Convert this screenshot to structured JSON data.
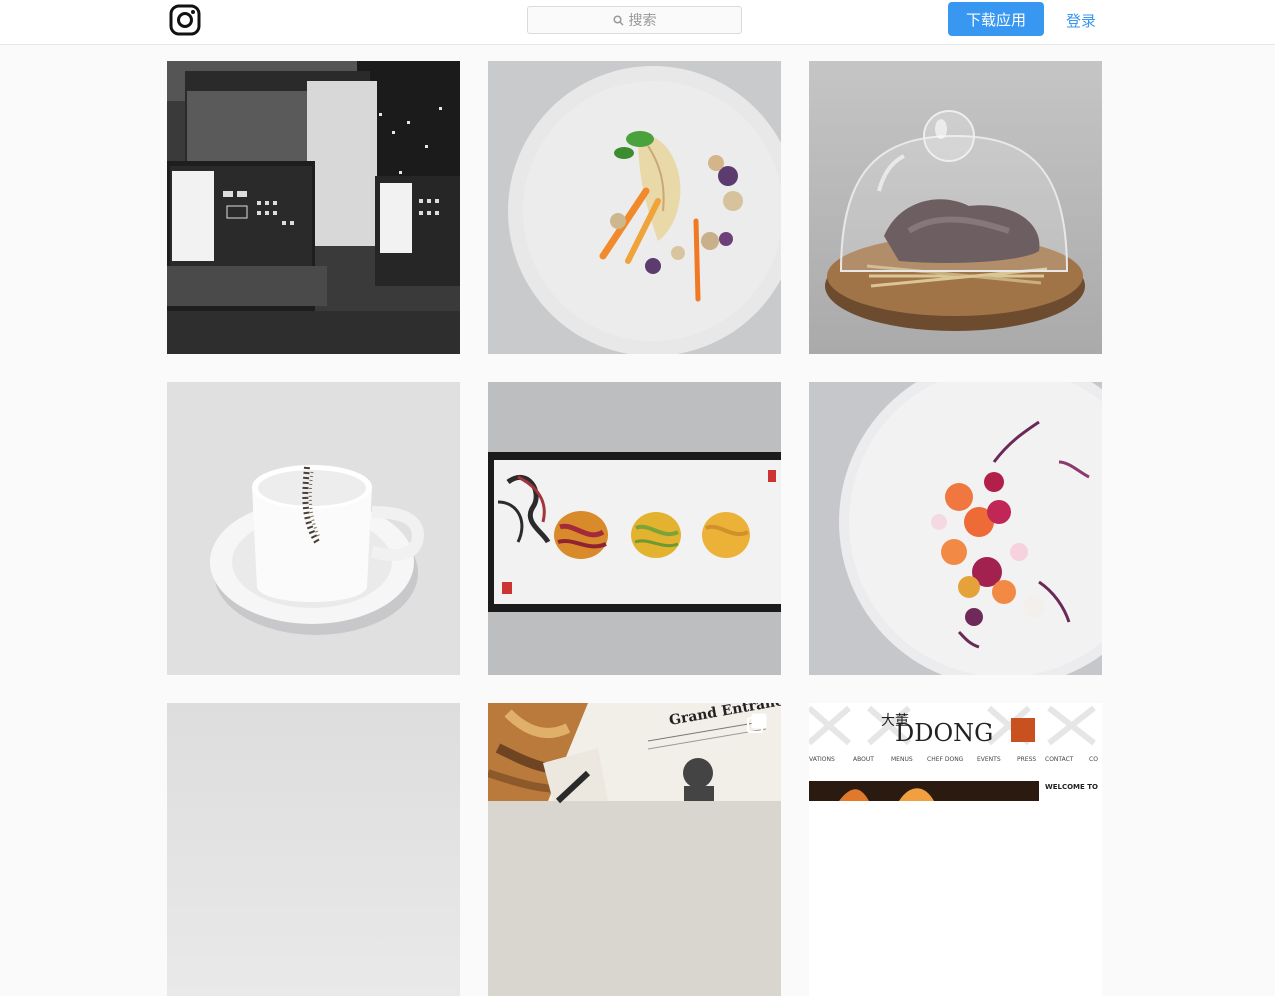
{
  "header": {
    "logo_icon": "instagram-camera-icon",
    "search": {
      "icon": "search-icon",
      "placeholder": "搜索"
    },
    "download_button": "下载应用",
    "login_link": "登录",
    "accent_color": "#3897f0"
  },
  "grid": {
    "posts": [
      {
        "subject": "black-and-white laptops by night window"
      },
      {
        "subject": "fish fillet with vegetables on white plate"
      },
      {
        "subject": "smoked duck under glass cloche"
      },
      {
        "subject": "white cup with foam and pepper"
      },
      {
        "subject": "three noodle bundles on framed tray"
      },
      {
        "subject": "colorful salad on white plate"
      },
      {
        "subject": "white textured surface"
      },
      {
        "subject": "restaurant magazine Grand Entrance",
        "text": "Grand Entrance",
        "multi_icon": "multiple-photos-icon"
      },
      {
        "subject": "restaurant website screenshot",
        "brand": "DDONG",
        "nav": [
          "VATIONS",
          "ABOUT",
          "MENUS",
          "CHEF DONG",
          "EVENTS",
          "PRESS",
          "CONTACT",
          "CO"
        ],
        "welcome": "WELCOME TO"
      }
    ]
  }
}
